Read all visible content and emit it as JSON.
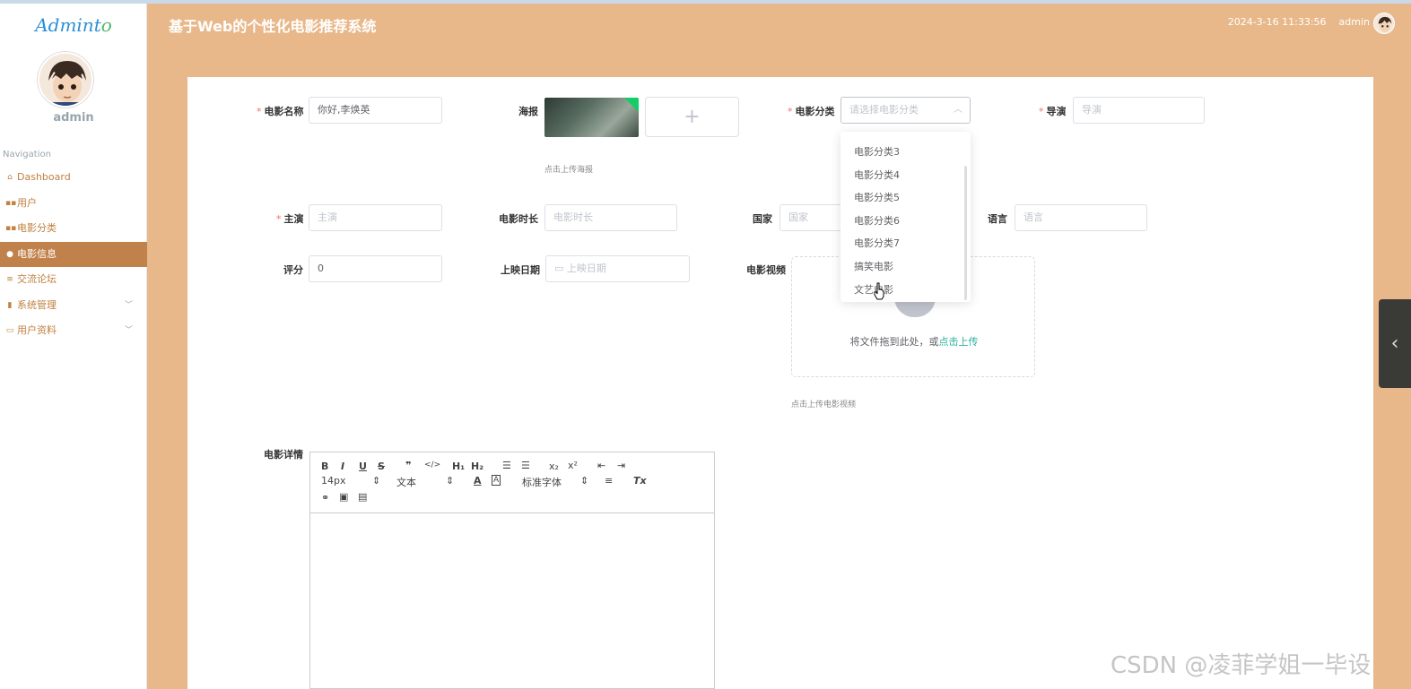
{
  "sidebar": {
    "logo_main": "Admint",
    "logo_end": "o",
    "user": "admin",
    "nav_heading": "Navigation",
    "items": [
      {
        "icon": "home-icon",
        "label": "Dashboard"
      },
      {
        "icon": "grid-icon",
        "label": "用户"
      },
      {
        "icon": "grid-icon",
        "label": "电影分类"
      },
      {
        "icon": "user-icon",
        "label": "电影信息"
      },
      {
        "icon": "list-icon",
        "label": "交流论坛"
      },
      {
        "icon": "chart-icon",
        "label": "系统管理"
      },
      {
        "icon": "card-icon",
        "label": "用户资料"
      }
    ]
  },
  "header": {
    "title": "基于Web的个性化电影推荐系统",
    "datetime": "2024-3-16 11:33:56",
    "user": "admin"
  },
  "form": {
    "movie_name": {
      "label": "电影名称",
      "value": "你好,李焕英"
    },
    "poster": {
      "label": "海报",
      "hint": "点击上传海报",
      "add": "+"
    },
    "category": {
      "label": "电影分类",
      "placeholder": "请选择电影分类",
      "arrow": "︿"
    },
    "director": {
      "label": "导演",
      "placeholder": "导演"
    },
    "actors": {
      "label": "主演",
      "placeholder": "主演"
    },
    "duration": {
      "label": "电影时长",
      "placeholder": "电影时长"
    },
    "country": {
      "label": "国家",
      "placeholder": "国家"
    },
    "language": {
      "label": "语言",
      "placeholder": "语言"
    },
    "rating": {
      "label": "评分",
      "value": "0"
    },
    "release_date": {
      "label": "上映日期",
      "placeholder": "上映日期"
    },
    "video": {
      "label": "电影视频",
      "drag_text": "将文件拖到此处，或",
      "upload_link": "点击上传",
      "hint": "点击上传电影视频"
    },
    "details": {
      "label": "电影详情"
    },
    "required_mark": "*"
  },
  "dropdown": {
    "options": [
      "电影分类3",
      "电影分类4",
      "电影分类5",
      "电影分类6",
      "电影分类7",
      "搞笑电影",
      "文艺电影"
    ]
  },
  "editor": {
    "font_size": "14px",
    "text_type": "文本",
    "font_family": "标准字体",
    "bold": "B",
    "italic": "I",
    "underline": "U",
    "strike": "S",
    "quote": "❞",
    "code": "</>",
    "h1": "H₁",
    "h2": "H₂",
    "sub": "x₂",
    "sup": "x²",
    "clean": "Tx"
  },
  "watermark": "CSDN @凌菲学姐一毕设",
  "side_toggle": "‹"
}
